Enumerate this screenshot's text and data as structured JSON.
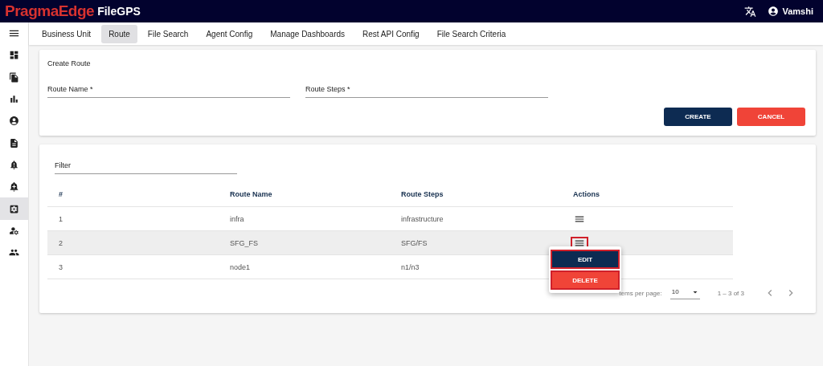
{
  "header": {
    "brand": "PragmaEdge",
    "product": "FileGPS",
    "user": "Vamshi"
  },
  "sidebar": {
    "items": [
      {
        "selected": false
      },
      {
        "selected": false
      },
      {
        "selected": false
      },
      {
        "selected": false
      },
      {
        "selected": false
      },
      {
        "selected": false
      },
      {
        "selected": false
      },
      {
        "selected": true
      },
      {
        "selected": false
      },
      {
        "selected": false
      }
    ]
  },
  "tabs": [
    {
      "label": "Business Unit",
      "selected": false
    },
    {
      "label": "Route",
      "selected": true
    },
    {
      "label": "File Search",
      "selected": false
    },
    {
      "label": "Agent Config",
      "selected": false
    },
    {
      "label": "Manage Dashboards",
      "selected": false
    },
    {
      "label": "Rest API Config",
      "selected": false
    },
    {
      "label": "File Search Criteria",
      "selected": false
    }
  ],
  "create_form": {
    "title": "Create Route",
    "fields": [
      {
        "placeholder": "Route Name *"
      },
      {
        "placeholder": "Route Steps *"
      }
    ],
    "buttons": [
      {
        "label": "CREATE",
        "kind": "primary"
      },
      {
        "label": "CANCEL",
        "kind": "danger"
      }
    ]
  },
  "table": {
    "filter": {
      "placeholder": "Filter"
    },
    "columns": [
      "#",
      "Route Name",
      "Route Steps",
      "Actions"
    ],
    "rows": [
      {
        "cells": [
          "1",
          "infra",
          "infrastructure"
        ],
        "selected": false,
        "menu_open": false
      },
      {
        "cells": [
          "2",
          "SFG_FS",
          "SFG/FS"
        ],
        "selected": true,
        "menu_open": true
      },
      {
        "cells": [
          "3",
          "node1",
          "n1/n3"
        ],
        "selected": false,
        "menu_open": false
      }
    ],
    "row_menu": [
      {
        "label": "EDIT",
        "kind": "edit"
      },
      {
        "label": "DELETE",
        "kind": "delete"
      }
    ],
    "paginator": {
      "label": "tems per page:",
      "page_size": "10",
      "range": "1 – 3 of 3"
    }
  }
}
